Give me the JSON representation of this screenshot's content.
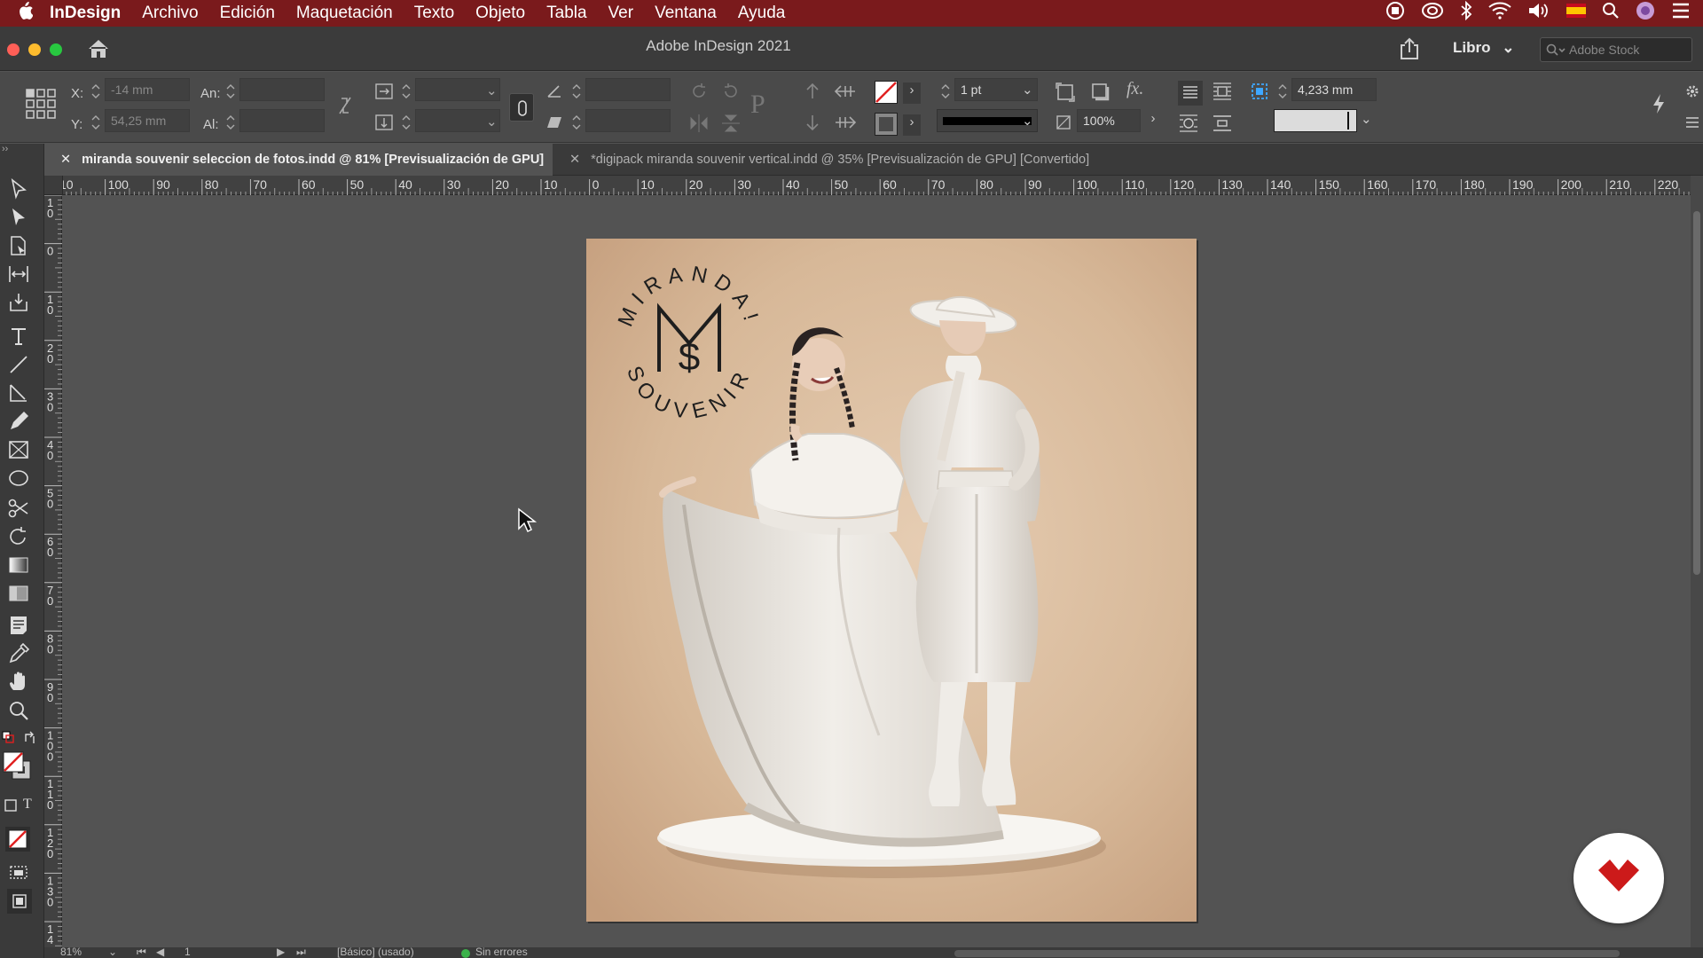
{
  "menubar": {
    "app_name": "InDesign",
    "items": [
      "Archivo",
      "Edición",
      "Maquetación",
      "Texto",
      "Objeto",
      "Tabla",
      "Ver",
      "Ventana",
      "Ayuda"
    ]
  },
  "window": {
    "title": "Adobe InDesign 2021",
    "workspace_label": "Libro",
    "stock_placeholder": "Adobe Stock"
  },
  "control": {
    "x_label": "X:",
    "x_value": "-14 mm",
    "y_label": "Y:",
    "y_value": "54,25 mm",
    "w_label": "An:",
    "h_label": "Al:",
    "stroke_weight": "1 pt",
    "opacity": "100%",
    "gutter": "4,233 mm"
  },
  "tabs": [
    {
      "label": "miranda souvenir seleccion de fotos.indd @ 81% [Previsualización de GPU]",
      "active": true
    },
    {
      "label": "*digipack miranda souvenir vertical.indd @ 35% [Previsualización de GPU] [Convertido]",
      "active": false
    }
  ],
  "ruler": {
    "h_ticks": [
      "10",
      "100",
      "90",
      "80",
      "70",
      "60",
      "50",
      "40",
      "30",
      "20",
      "10",
      "0",
      "10",
      "20",
      "30",
      "40",
      "50",
      "60",
      "70",
      "80",
      "90",
      "100",
      "110",
      "120",
      "130",
      "140",
      "150",
      "160",
      "170",
      "180",
      "190",
      "200",
      "210",
      "220"
    ],
    "v_ticks": [
      "1 0",
      "0",
      "1 0",
      "2 0",
      "3 0",
      "4 0",
      "5 0",
      "6 0",
      "7 0",
      "8 0",
      "9 0",
      "1 0 0",
      "1 1 0",
      "1 2 0",
      "1 3 0",
      "1 4"
    ]
  },
  "page": {
    "logo_arc_top": "MIRANDA!",
    "logo_arc_bottom": "SOUVENIR",
    "logo_monogram": "M",
    "logo_symbol": "$"
  },
  "status": {
    "zoom": "81%",
    "page": "1",
    "style": "[Básico] (usado)",
    "preflight": "Sin errores"
  },
  "colors": {
    "menubar": "#7a1a1c",
    "page_bg": "#d9bea4",
    "preflight_ok": "#3bb24a",
    "float_icon": "#cc1a1a"
  }
}
